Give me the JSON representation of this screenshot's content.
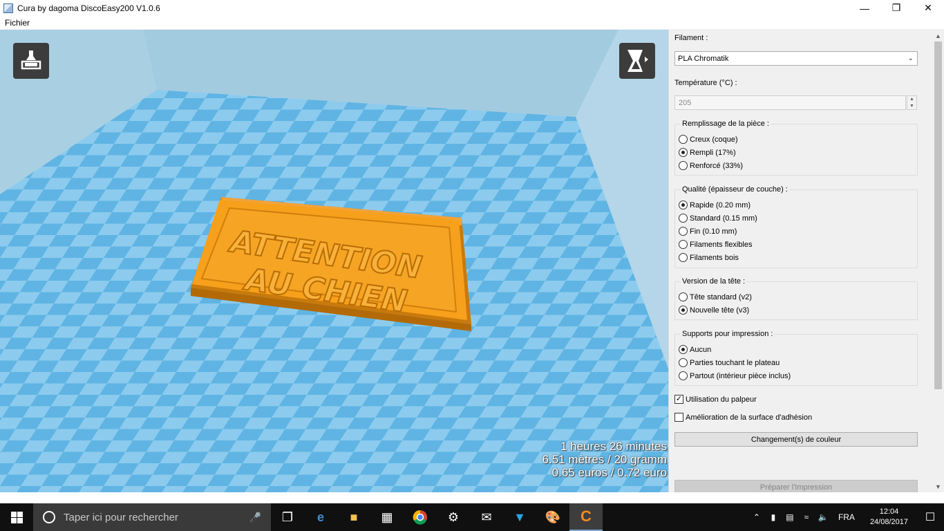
{
  "window": {
    "title": "Cura by dagoma DiscoEasy200 V1.0.6",
    "minimize_glyph": "—",
    "maximize_glyph": "❐",
    "close_glyph": "✕"
  },
  "menu": {
    "file": "Fichier"
  },
  "viewport": {
    "model_text_line1": "ATTENTION",
    "model_text_line2": "AU CHIEN",
    "model_color": "#f7a01c",
    "bed_colors": [
      "#5fb4e3",
      "#8ccbee"
    ],
    "stats": {
      "time": "1 heures 26 minutes",
      "material": "6.51 mètres / 20 gramm",
      "cost": "0.65 euros / 0.72 euro"
    },
    "left_tool_icon": "load-model-icon",
    "right_tool_icon": "rotate-view-icon"
  },
  "panel": {
    "filament_label": "Filament :",
    "filament_value": "PLA Chromatik",
    "temperature_label": "Température (°C) :",
    "temperature_value": "205",
    "infill": {
      "title": "Remplissage de la pièce :",
      "options": [
        "Creux (coque)",
        "Rempli (17%)",
        "Renforcé (33%)"
      ],
      "selected_index": 1
    },
    "quality": {
      "title": "Qualité (épaisseur de couche) :",
      "options": [
        "Rapide (0.20 mm)",
        "Standard (0.15 mm)",
        "Fin (0.10 mm)",
        "Filaments flexibles",
        "Filaments bois"
      ],
      "selected_index": 0
    },
    "head": {
      "title": "Version de la tête :",
      "options": [
        "Tête standard (v2)",
        "Nouvelle tête (v3)"
      ],
      "selected_index": 1
    },
    "supports": {
      "title": "Supports pour impression :",
      "options": [
        "Aucun",
        "Parties touchant le plateau",
        "Partout (intérieur pièce inclus)"
      ],
      "selected_index": 0
    },
    "probe_label": "Utilisation du palpeur",
    "probe_checked": true,
    "adhesion_label": "Amélioration de la surface d'adhésion",
    "adhesion_checked": false,
    "color_change_button": "Changement(s) de couleur",
    "prepare_button": "Préparer l'Impression"
  },
  "taskbar": {
    "search_placeholder": "Taper ici pour rechercher",
    "apps": [
      "task-view-icon",
      "edge-icon",
      "file-explorer-icon",
      "store-icon",
      "chrome-icon",
      "settings-icon",
      "mail-icon",
      "app-arrow-icon",
      "paint-icon",
      "cura-icon"
    ],
    "language": "FRA",
    "time": "12:04",
    "date": "24/08/2017"
  }
}
